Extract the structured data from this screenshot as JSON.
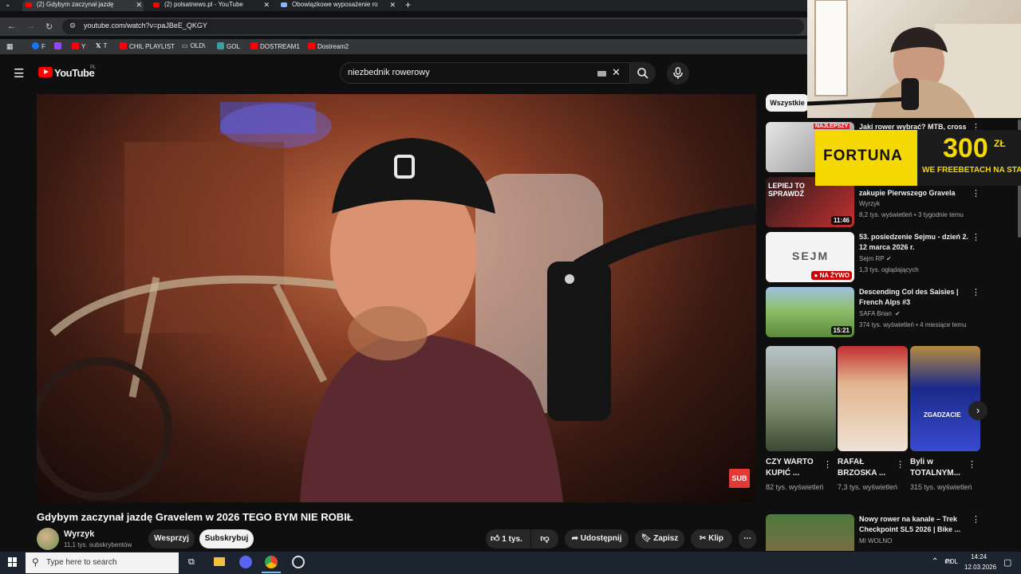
{
  "browser": {
    "tabs": [
      {
        "title": "(2) Gdybym zaczynał jazdę",
        "active": true
      },
      {
        "title": "(2) polsatnews.pl - YouTube",
        "active": false
      },
      {
        "title": "Obowiązkowe wyposażenie ro",
        "active": false
      }
    ],
    "new_tab": "+",
    "url": "youtube.com/watch?v=paJBeE_QKGY",
    "bookmarks": [
      "F",
      "Y",
      "T",
      "CHIL PLAYLIST",
      "OLD\\",
      "GOL",
      "DOSTREAM1",
      "Dostream2"
    ]
  },
  "youtube": {
    "logo_text": "YouTube",
    "logo_region": "PL",
    "search_value": "niezbednik rowerowy",
    "video": {
      "title": "Gdybym zaczynał jazdę Gravelem w 2026 TEGO BYM NIE ROBIŁ",
      "sub_badge": "SUB",
      "channel": "Wyrzyk",
      "subscribers": "11,1 tys. subskrybentów",
      "support_label": "Wesprzyj",
      "subscribe_label": "Subskrybuj",
      "likes": "1 tys.",
      "share_label": "Udostępnij",
      "save_label": "Zapisz",
      "clip_label": "Klip"
    },
    "filter_chip": "Wszystkie",
    "sidebar": [
      {
        "title": "Jaki rower wybrać? MTB, cross",
        "channel": "",
        "meta": "",
        "duration": "",
        "thumb_text": "NAJLEPSZY"
      },
      {
        "title": "zakupie Pierwszego Gravela",
        "channel": "Wyrzyk",
        "meta": "8,2 tys. wyświetleń • 3 tygodnie temu",
        "duration": "11:46",
        "thumb_text": "LEPIEJ TO SPRAWDŹ"
      },
      {
        "title": "53. posiedzenie Sejmu - dzień 2. 12 marca 2026 r.",
        "channel": "Sejm RP",
        "meta": "1,3 tys. oglądających",
        "duration": "",
        "thumb_text": "SEJM",
        "live": "NA ŻYWO"
      },
      {
        "title": "Descending Col des Saisies | French Alps #3",
        "channel": "SAFA Brian",
        "meta": "374 tys. wyświetleń • 4 miesiące temu",
        "duration": "15:21",
        "thumb_text": ""
      },
      {
        "title": "Nowy rower na kanale – Trek Checkpoint SL5 2026 | Bike ...",
        "channel": "MI WOLNO",
        "meta": "",
        "duration": "",
        "thumb_text": ""
      }
    ],
    "shorts": [
      {
        "title": "CZY WARTO KUPIĆ ...",
        "views": "82 tys. wyświetleń",
        "thumb_text": ""
      },
      {
        "title": "RAFAŁ BRZOSKA ...",
        "views": "7,3 tys. wyświetleń",
        "thumb_text": ""
      },
      {
        "title": "Byli w TOTALNYM...",
        "views": "315 tys. wyświetleń",
        "thumb_text": "ZGADZACIE"
      }
    ]
  },
  "ad": {
    "brand": "FORTUNA",
    "amount": "300",
    "currency": "ZŁ",
    "tagline": "WE FREEBETACH NA STAS"
  },
  "taskbar": {
    "search_placeholder": "Type here to search",
    "lang": "POL",
    "time": "14:24",
    "date": "12.03.2026"
  },
  "colors": {
    "yt_red": "#ff0000",
    "fortuna_yellow": "#f5d800",
    "bg": "#0f0f0f"
  }
}
